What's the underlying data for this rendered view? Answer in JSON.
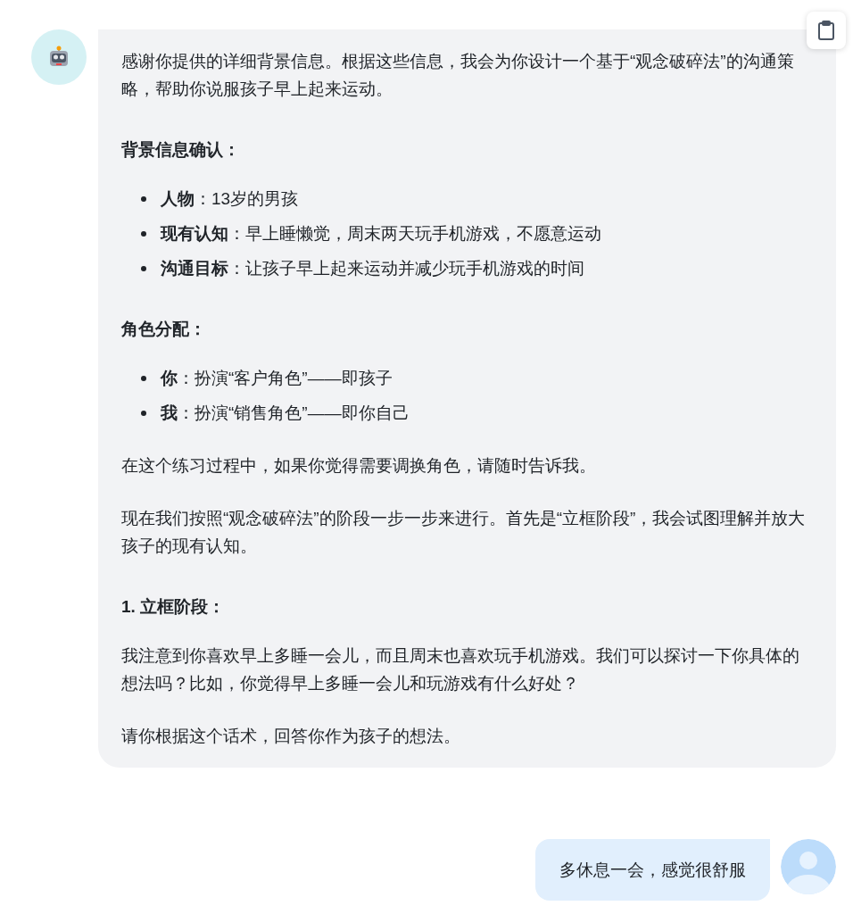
{
  "bot_message": {
    "blocks": [
      {
        "kind": "paragraph",
        "text": "感谢你提供的详细背景信息。根据这些信息，我会为你设计一个基于“观念破碎法”的沟通策略，帮助你说服孩子早上起来运动。"
      },
      {
        "kind": "heading",
        "text": "背景信息确认："
      },
      {
        "kind": "list",
        "items": [
          "**人物**：13岁的男孩",
          "**现有认知**：早上睡懒觉，周末两天玩手机游戏，不愿意运动",
          "**沟通目标**：让孩子早上起来运动并减少玩手机游戏的时间"
        ]
      },
      {
        "kind": "heading",
        "text": "角色分配："
      },
      {
        "kind": "list",
        "items": [
          "**你**：扮演“客户角色”——即孩子",
          "**我**：扮演“销售角色”——即你自己"
        ]
      },
      {
        "kind": "paragraph",
        "text": "在这个练习过程中，如果你觉得需要调换角色，请随时告诉我。"
      },
      {
        "kind": "paragraph",
        "text": "现在我们按照“观念破碎法”的阶段一步一步来进行。首先是“立框阶段”，我会试图理解并放大孩子的现有认知。"
      },
      {
        "kind": "heading",
        "text": "1. 立框阶段："
      },
      {
        "kind": "paragraph",
        "text": "我注意到你喜欢早上多睡一会儿，而且周末也喜欢玩手机游戏。我们可以探讨一下你具体的想法吗？比如，你觉得早上多睡一会儿和玩游戏有什么好处？"
      },
      {
        "kind": "paragraph",
        "text": "请你根据这个话术，回答你作为孩子的想法。"
      }
    ]
  },
  "user_message": {
    "text": "多休息一会，感觉很舒服"
  }
}
